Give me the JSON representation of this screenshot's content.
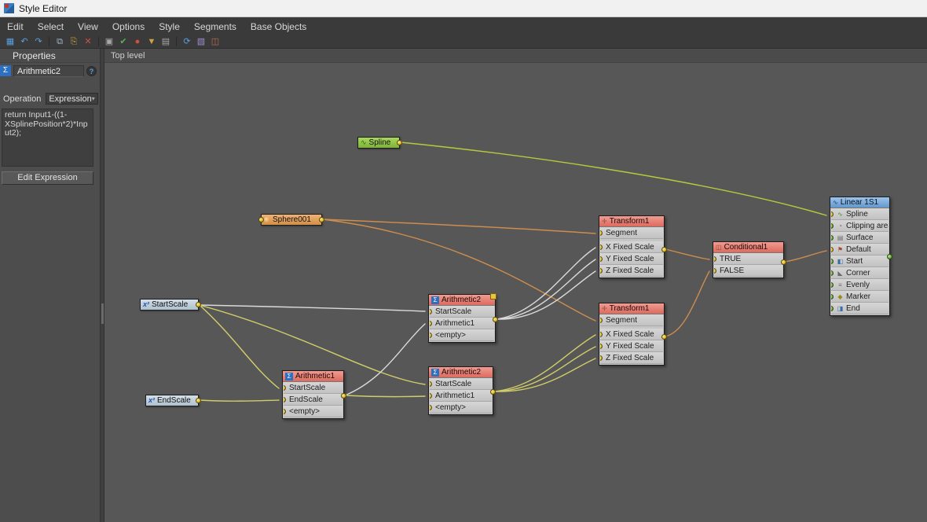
{
  "window": {
    "title": "Style Editor"
  },
  "menubar": {
    "items": [
      "Edit",
      "Select",
      "View",
      "Options",
      "Style",
      "Segments",
      "Base Objects"
    ]
  },
  "toolbar": {
    "items": [
      {
        "name": "new-style",
        "glyph": "▦"
      },
      {
        "name": "undo",
        "glyph": "↶"
      },
      {
        "name": "redo",
        "glyph": "↷"
      },
      {
        "name": "copy",
        "glyph": "⧉"
      },
      {
        "name": "paste",
        "glyph": "⎘"
      },
      {
        "name": "delete",
        "glyph": "✕"
      },
      {
        "name": "snapshot",
        "glyph": "▣"
      },
      {
        "name": "commit",
        "glyph": "✔"
      },
      {
        "name": "abort",
        "glyph": "●"
      },
      {
        "name": "filter",
        "glyph": "▼"
      },
      {
        "name": "trash",
        "glyph": "▤"
      },
      {
        "name": "refresh",
        "glyph": "⟳"
      },
      {
        "name": "layout",
        "glyph": "▧"
      },
      {
        "name": "report",
        "glyph": "◫"
      }
    ]
  },
  "sidebar": {
    "tab": "Properties",
    "node_name": "Arithmetic2",
    "help": "?",
    "operation_label": "Operation",
    "operation_value": "Expression",
    "expression_lines": [
      "return Input1-((1-",
      "XSplinePosition*2)*Inp",
      "ut2);"
    ],
    "edit_button": "Edit Expression"
  },
  "canvas": {
    "tab": "Top level",
    "nodes": {
      "spline": {
        "title": "Spline"
      },
      "sphere": {
        "title": "Sphere001"
      },
      "startscale": {
        "title": "StartScale"
      },
      "endscale": {
        "title": "EndScale"
      },
      "arith2a": {
        "title": "Arithmetic2",
        "rows": [
          "StartScale",
          "Arithmetic1",
          "<empty>"
        ]
      },
      "arith1": {
        "title": "Arithmetic1",
        "rows": [
          "StartScale",
          "EndScale",
          "<empty>"
        ]
      },
      "arith2b": {
        "title": "Arithmetic2",
        "rows": [
          "StartScale",
          "Arithmetic1",
          "<empty>"
        ]
      },
      "transform_a": {
        "title": "Transform1",
        "rows": [
          "Segment",
          "X Fixed Scale",
          "Y Fixed Scale",
          "Z Fixed Scale"
        ]
      },
      "transform_b": {
        "title": "Transform1",
        "rows": [
          "Segment",
          "X Fixed Scale",
          "Y Fixed Scale",
          "Z Fixed Scale"
        ]
      },
      "conditional": {
        "title": "Conditional1",
        "rows": [
          "TRUE",
          "FALSE"
        ]
      },
      "linear": {
        "title": "Linear 1S1",
        "rows": [
          "Spline",
          "Clipping area",
          "Surface",
          "Default",
          "Start",
          "Corner",
          "Evenly",
          "Marker",
          "End"
        ]
      }
    },
    "palette": {
      "wire_green": "#b9c93c",
      "wire_orange": "#cd8d4d",
      "wire_white": "#dadada",
      "wire_yellow": "#d2cd6a",
      "header_red": "#e8746a",
      "header_blue": "#74a9dd",
      "spline_green": "#93c83e",
      "sphere_orange": "#e2a05c",
      "value_blue": "#c3d2df",
      "port_yellow": "#d9b621",
      "port_green": "#6da63c"
    }
  },
  "icons": {
    "sigma": "Σ",
    "x_squared": "x²",
    "wave": "∿",
    "transform": "✛",
    "conditional": "◫",
    "caret": "▾",
    "clipping": "◔",
    "surface": "▤",
    "flag": "⚑",
    "start": "◧",
    "corner": "◣",
    "evenly": "≡",
    "marker": "◆",
    "end": "◨"
  }
}
